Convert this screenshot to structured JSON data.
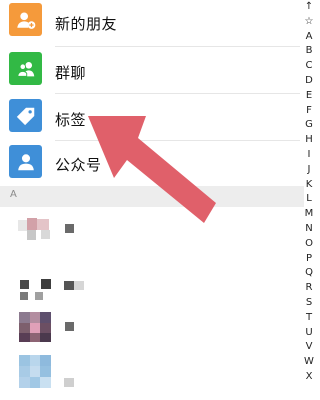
{
  "menu": {
    "new_friends": "新的朋友",
    "group_chats": "群聊",
    "tags": "标签",
    "official_accounts": "公众号"
  },
  "section": {
    "letter": "A"
  },
  "index_bar": [
    "↑",
    "☆",
    "A",
    "B",
    "C",
    "D",
    "E",
    "F",
    "G",
    "H",
    "I",
    "J",
    "K",
    "L",
    "M",
    "N",
    "O",
    "P",
    "Q",
    "R",
    "S",
    "T",
    "U",
    "V",
    "W",
    "X"
  ],
  "colors": {
    "new_friends_icon": "#f59a3b",
    "group_chats_icon": "#32b945",
    "tags_icon": "#3f8fd8",
    "official_accounts_icon": "#3f8fd8",
    "arrow": "#e0606a"
  },
  "icons": {
    "new_friends": "add-friend-icon",
    "group_chats": "group-icon",
    "tags": "tag-icon",
    "official_accounts": "person-icon"
  }
}
